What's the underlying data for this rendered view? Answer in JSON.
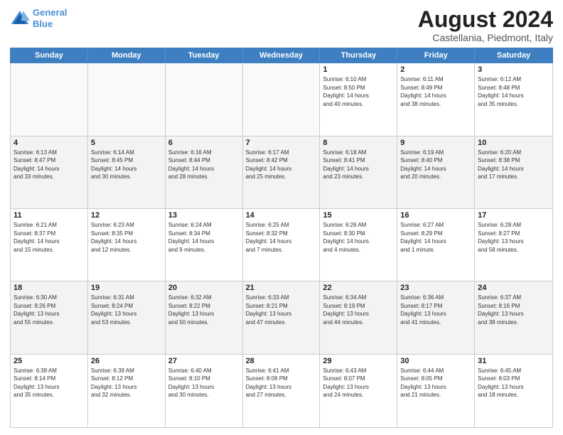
{
  "header": {
    "logo_line1": "General",
    "logo_line2": "Blue",
    "month_year": "August 2024",
    "location": "Castellania, Piedmont, Italy"
  },
  "weekdays": [
    "Sunday",
    "Monday",
    "Tuesday",
    "Wednesday",
    "Thursday",
    "Friday",
    "Saturday"
  ],
  "rows": [
    [
      {
        "day": "",
        "text": ""
      },
      {
        "day": "",
        "text": ""
      },
      {
        "day": "",
        "text": ""
      },
      {
        "day": "",
        "text": ""
      },
      {
        "day": "1",
        "text": "Sunrise: 6:10 AM\nSunset: 8:50 PM\nDaylight: 14 hours\nand 40 minutes."
      },
      {
        "day": "2",
        "text": "Sunrise: 6:11 AM\nSunset: 8:49 PM\nDaylight: 14 hours\nand 38 minutes."
      },
      {
        "day": "3",
        "text": "Sunrise: 6:12 AM\nSunset: 8:48 PM\nDaylight: 14 hours\nand 35 minutes."
      }
    ],
    [
      {
        "day": "4",
        "text": "Sunrise: 6:13 AM\nSunset: 8:47 PM\nDaylight: 14 hours\nand 33 minutes."
      },
      {
        "day": "5",
        "text": "Sunrise: 6:14 AM\nSunset: 8:45 PM\nDaylight: 14 hours\nand 30 minutes."
      },
      {
        "day": "6",
        "text": "Sunrise: 6:16 AM\nSunset: 8:44 PM\nDaylight: 14 hours\nand 28 minutes."
      },
      {
        "day": "7",
        "text": "Sunrise: 6:17 AM\nSunset: 8:42 PM\nDaylight: 14 hours\nand 25 minutes."
      },
      {
        "day": "8",
        "text": "Sunrise: 6:18 AM\nSunset: 8:41 PM\nDaylight: 14 hours\nand 23 minutes."
      },
      {
        "day": "9",
        "text": "Sunrise: 6:19 AM\nSunset: 8:40 PM\nDaylight: 14 hours\nand 20 minutes."
      },
      {
        "day": "10",
        "text": "Sunrise: 6:20 AM\nSunset: 8:38 PM\nDaylight: 14 hours\nand 17 minutes."
      }
    ],
    [
      {
        "day": "11",
        "text": "Sunrise: 6:21 AM\nSunset: 8:37 PM\nDaylight: 14 hours\nand 15 minutes."
      },
      {
        "day": "12",
        "text": "Sunrise: 6:23 AM\nSunset: 8:35 PM\nDaylight: 14 hours\nand 12 minutes."
      },
      {
        "day": "13",
        "text": "Sunrise: 6:24 AM\nSunset: 8:34 PM\nDaylight: 14 hours\nand 9 minutes."
      },
      {
        "day": "14",
        "text": "Sunrise: 6:25 AM\nSunset: 8:32 PM\nDaylight: 14 hours\nand 7 minutes."
      },
      {
        "day": "15",
        "text": "Sunrise: 6:26 AM\nSunset: 8:30 PM\nDaylight: 14 hours\nand 4 minutes."
      },
      {
        "day": "16",
        "text": "Sunrise: 6:27 AM\nSunset: 8:29 PM\nDaylight: 14 hours\nand 1 minute."
      },
      {
        "day": "17",
        "text": "Sunrise: 6:28 AM\nSunset: 8:27 PM\nDaylight: 13 hours\nand 58 minutes."
      }
    ],
    [
      {
        "day": "18",
        "text": "Sunrise: 6:30 AM\nSunset: 8:26 PM\nDaylight: 13 hours\nand 55 minutes."
      },
      {
        "day": "19",
        "text": "Sunrise: 6:31 AM\nSunset: 8:24 PM\nDaylight: 13 hours\nand 53 minutes."
      },
      {
        "day": "20",
        "text": "Sunrise: 6:32 AM\nSunset: 8:22 PM\nDaylight: 13 hours\nand 50 minutes."
      },
      {
        "day": "21",
        "text": "Sunrise: 6:33 AM\nSunset: 8:21 PM\nDaylight: 13 hours\nand 47 minutes."
      },
      {
        "day": "22",
        "text": "Sunrise: 6:34 AM\nSunset: 8:19 PM\nDaylight: 13 hours\nand 44 minutes."
      },
      {
        "day": "23",
        "text": "Sunrise: 6:36 AM\nSunset: 8:17 PM\nDaylight: 13 hours\nand 41 minutes."
      },
      {
        "day": "24",
        "text": "Sunrise: 6:37 AM\nSunset: 8:16 PM\nDaylight: 13 hours\nand 38 minutes."
      }
    ],
    [
      {
        "day": "25",
        "text": "Sunrise: 6:38 AM\nSunset: 8:14 PM\nDaylight: 13 hours\nand 35 minutes."
      },
      {
        "day": "26",
        "text": "Sunrise: 6:39 AM\nSunset: 8:12 PM\nDaylight: 13 hours\nand 32 minutes."
      },
      {
        "day": "27",
        "text": "Sunrise: 6:40 AM\nSunset: 8:10 PM\nDaylight: 13 hours\nand 30 minutes."
      },
      {
        "day": "28",
        "text": "Sunrise: 6:41 AM\nSunset: 8:09 PM\nDaylight: 13 hours\nand 27 minutes."
      },
      {
        "day": "29",
        "text": "Sunrise: 6:43 AM\nSunset: 8:07 PM\nDaylight: 13 hours\nand 24 minutes."
      },
      {
        "day": "30",
        "text": "Sunrise: 6:44 AM\nSunset: 8:05 PM\nDaylight: 13 hours\nand 21 minutes."
      },
      {
        "day": "31",
        "text": "Sunrise: 6:45 AM\nSunset: 8:03 PM\nDaylight: 13 hours\nand 18 minutes."
      }
    ]
  ]
}
